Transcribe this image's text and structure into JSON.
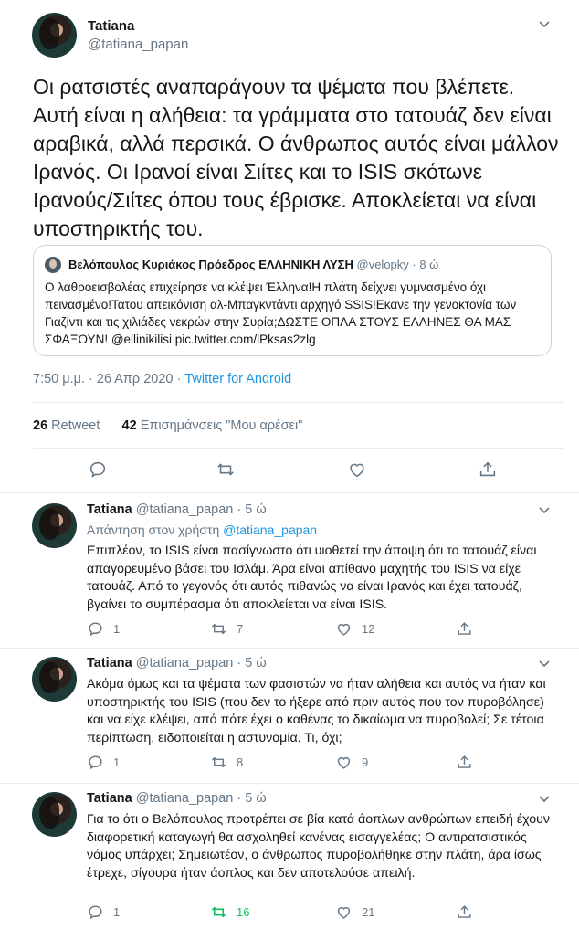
{
  "main": {
    "name": "Tatiana",
    "handle": "@tatiana_papan",
    "text": "Οι ρατσιστές αναπαράγουν τα ψέματα που βλέπετε. Αυτή είναι η αλήθεια: τα γράμματα στο τατουάζ δεν είναι αραβικά, αλλά περσικά. Ο άνθρωπος αυτός είναι μάλλον Ιρανός. Οι Ιρανοί είναι Σιίτες και το ISIS σκότωνε Ιρανούς/Σιίτες όπου τους έβρισκε. Αποκλείεται να είναι υποστηρικτής του.",
    "quote": {
      "name": "Βελόπουλος Κυριάκος Πρόεδρος ΕΛΛΗΝΙΚΗ ΛΥΣΗ",
      "meta": "@velopky · 8 ώ",
      "text": "Ο λαθροεισβολέας επιχείρησε να κλέψει Έλληνα!Η πλάτη δείχνει γυμνασμένο όχι πεινασμένο!Τατου απεικόνιση αλ-Μπαγκντάντι αρχηγό SSIS!Εκανε την γενοκτονία των Γιαζίντι και τις χιλιάδες νεκρών στην Συρία;ΔΩΣΤΕ ΟΠΛΑ ΣΤΟΥΣ ΕΛΛΗΝΕΣ ΘΑ ΜΑΣ ΣΦΑΞΟΥΝ! @ellinikilisi pic.twitter.com/lPksas2zlg"
    },
    "time": "7:50 μ.μ. · 26 Απρ 2020",
    "dot": " · ",
    "via": "Twitter for Android",
    "retweets_count": "26",
    "retweets_label": "Retweet",
    "likes_count": "42",
    "likes_label": "Επισημάνσεις \"Μου αρέσει\""
  },
  "replies": [
    {
      "name": "Tatiana",
      "meta": "@tatiana_papan · 5 ώ",
      "reply_to_label": "Απάντηση στον χρήστη",
      "reply_to_handle": "@tatiana_papan",
      "text": "Επιπλέον, το ISIS είναι πασίγνωστο ότι υιοθετεί την άποψη ότι το τατουάζ είναι απαγορευμένο βάσει του Ισλάμ. Άρα είναι απίθανο μαχητής του ISIS να είχε τατουάζ. Από το γεγονός ότι αυτός πιθανώς να είναι Ιρανός και έχει τατουάζ, βγαίνει το συμπέρασμα ότι αποκλείεται να είναι ISIS.",
      "replies": "1",
      "retweets": "7",
      "likes": "12"
    },
    {
      "name": "Tatiana",
      "meta": "@tatiana_papan · 5 ώ",
      "text": "Ακόμα όμως και τα ψέματα των φασιστών να ήταν αλήθεια και αυτός να ήταν και υποστηρικτής του ISIS (που δεν το ήξερε από πριν αυτός που τον πυροβόλησε) και να είχε κλέψει, από πότε έχει ο καθένας το δικαίωμα να πυροβολεί; Σε τέτοια περίπτωση, ειδοποιείται η αστυνομία. Τι, όχι;",
      "replies": "1",
      "retweets": "8",
      "likes": "9"
    },
    {
      "name": "Tatiana",
      "meta": "@tatiana_papan · 5 ώ",
      "text": "Για το ότι ο Βελόπουλος προτρέπει σε βία κατά άοπλων ανθρώπων επειδή έχουν διαφορετική καταγωγή θα ασχοληθεί κανένας εισαγγελέας; Ο αντιρατσιστικός νόμος υπάρχει; Σημειωτέον, ο άνθρωπος πυροβολήθηκε στην πλάτη, άρα ίσως έτρεχε, σίγουρα ήταν άοπλος και δεν αποτελούσε απειλή.",
      "replies": "1",
      "retweets": "16",
      "likes": "21"
    }
  ],
  "colors": {
    "text": "#14171a",
    "secondary": "#657786",
    "link": "#1b95e0",
    "retweet_active": "#17bf63",
    "border": "#e6ecf0"
  },
  "icons": [
    "chevron-down-icon",
    "reply-icon",
    "retweet-icon",
    "like-icon",
    "share-icon"
  ]
}
